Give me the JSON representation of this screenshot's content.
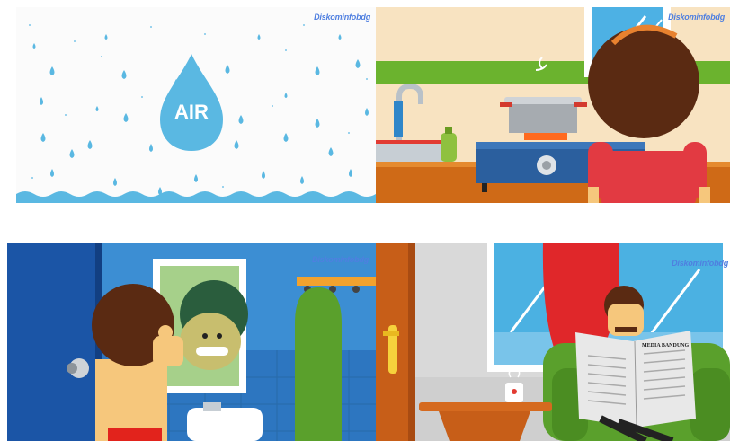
{
  "watermark": "Diskominfobdg",
  "panels": {
    "rain": {
      "label": "AIR"
    },
    "newspaper": {
      "masthead": "MEDIA BANDUNG"
    }
  },
  "colors": {
    "water": "#5ab8e2",
    "kitchen_wall": "#f8e3c1",
    "bathroom_wall": "#2e7cc4",
    "curtain": "#e0272a",
    "armchair": "#5aa02c",
    "skin": "#f6c77c",
    "hair": "#5a2a12"
  }
}
